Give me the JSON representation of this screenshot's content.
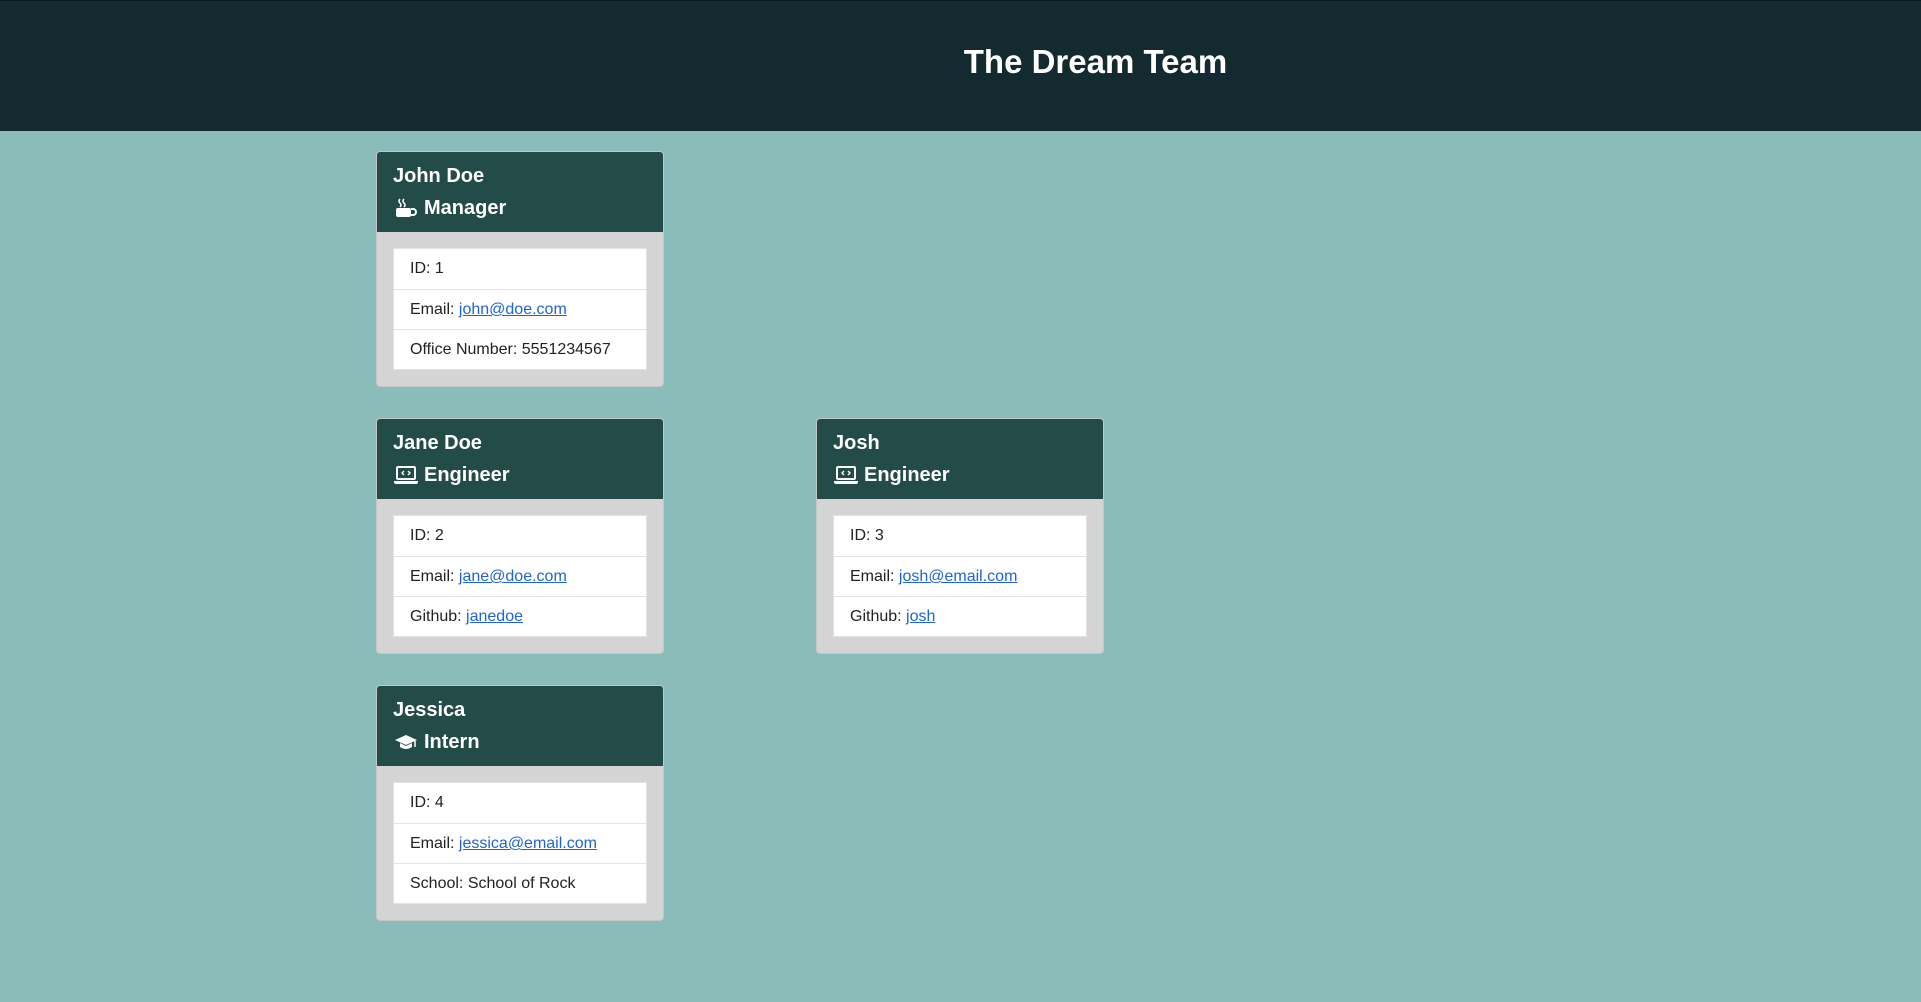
{
  "header": {
    "title": "The Dream Team"
  },
  "colors": {
    "header_bg": "#142a31",
    "page_bg": "#8abcba",
    "card_header_bg": "#234b47",
    "link": "#1e64d2"
  },
  "employees": [
    {
      "name": "John Doe",
      "role": "Manager",
      "icon": "mug-hot-icon",
      "id_label": "ID:",
      "id": "1",
      "email_label": "Email:",
      "email": "john@doe.com",
      "extra_label": "Office Number:",
      "extra_value": "5551234567"
    },
    {
      "name": "Jane Doe",
      "role": "Engineer",
      "icon": "laptop-code-icon",
      "id_label": "ID:",
      "id": "2",
      "email_label": "Email:",
      "email": "jane@doe.com",
      "extra_label": "Github:",
      "extra_value": "janedoe"
    },
    {
      "name": "Josh",
      "role": "Engineer",
      "icon": "laptop-code-icon",
      "id_label": "ID:",
      "id": "3",
      "email_label": "Email:",
      "email": "josh@email.com",
      "extra_label": "Github:",
      "extra_value": "josh"
    },
    {
      "name": "Jessica",
      "role": "Intern",
      "icon": "graduation-cap-icon",
      "id_label": "ID:",
      "id": "4",
      "email_label": "Email:",
      "email": "jessica@email.com",
      "extra_label": "School:",
      "extra_value": "School of Rock"
    }
  ]
}
